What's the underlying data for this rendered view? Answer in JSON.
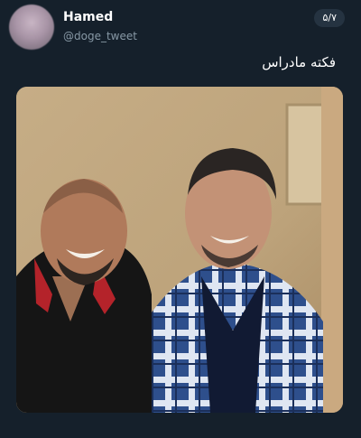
{
  "tweet": {
    "display_name": "Hamed",
    "handle": "@doge_tweet",
    "counter": "۵/۷",
    "text": "فکته مادراس"
  },
  "media": {
    "icon": "photo-icon"
  },
  "colors": {
    "background": "#15202b",
    "secondary_text": "#8899a6",
    "badge": "#253341"
  }
}
